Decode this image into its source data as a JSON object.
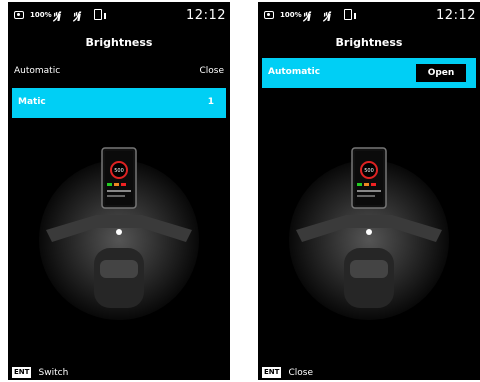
{
  "statusbar": {
    "battery": "100%",
    "signal_glyph": "ﾂi",
    "time": "12:12"
  },
  "left_screen": {
    "title": "Brightness",
    "automatic_label": "Automatic",
    "automatic_value": "Close",
    "matic_label": "Matic",
    "matic_value": "1",
    "footer_key": "ENT",
    "footer_action": "Switch"
  },
  "right_screen": {
    "title": "Brightness",
    "automatic_label": "Automatic",
    "open_button": "Open",
    "footer_key": "ENT",
    "footer_action": "Close"
  },
  "colors": {
    "highlight": "#00cff5",
    "background": "#000000",
    "text": "#ffffff"
  },
  "icons": [
    "camera-icon",
    "signal-icon",
    "phone-icon",
    "motorcycle-dashboard-image"
  ]
}
